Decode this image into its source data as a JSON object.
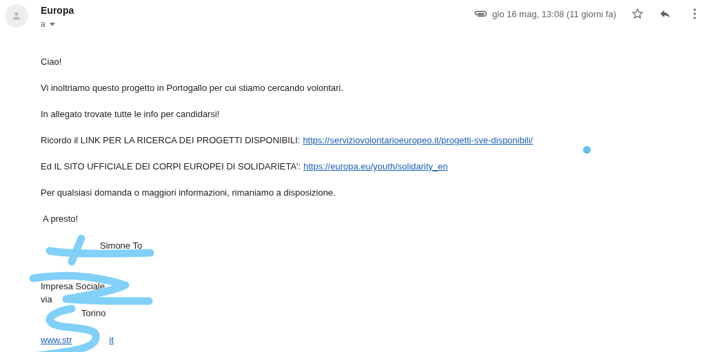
{
  "sender": {
    "name": "Europa",
    "recipient": "a"
  },
  "meta": {
    "date": "gio 16 mag, 13:08 (11 giorni fa)",
    "starred": false
  },
  "body": [
    {
      "kind": "text",
      "text": "Ciao!"
    },
    {
      "kind": "text",
      "text": "Vi inoltriamo questo progetto in Portogallo per cui stiamo cercando volontari."
    },
    {
      "kind": "text",
      "text": "In allegato trovate tutte le info per candidarsi!"
    },
    {
      "kind": "link",
      "text": "Ricordo il LINK PER LA RICERCA DEI PROGETTI DISPONIBILI:",
      "link": "https://serviziovolontarioeuropeo.it/progetti-sve-disponibili/"
    },
    {
      "kind": "link",
      "text": "Ed IL SITO UFFICIALE DEI CORPI EUROPEI DI SOLIDARIETA':",
      "link": "https://europa.eu/youth/solidarity_en"
    },
    {
      "kind": "text",
      "text": "Per qualsiasi domanda o maggiori informazioni, rimaniamo a disposizione."
    },
    {
      "kind": "text",
      "text": " A presto!"
    }
  ],
  "signature": [
    {
      "kind": "name",
      "text": "Simone To"
    },
    {
      "kind": "blank"
    },
    {
      "kind": "blank"
    },
    {
      "kind": "line",
      "text": "Impresa Sociale"
    },
    {
      "kind": "line",
      "text": "via"
    },
    {
      "kind": "place",
      "text": "Torino"
    },
    {
      "kind": "blank"
    },
    {
      "kind": "web",
      "text": "www.str",
      "link": "it"
    }
  ]
}
